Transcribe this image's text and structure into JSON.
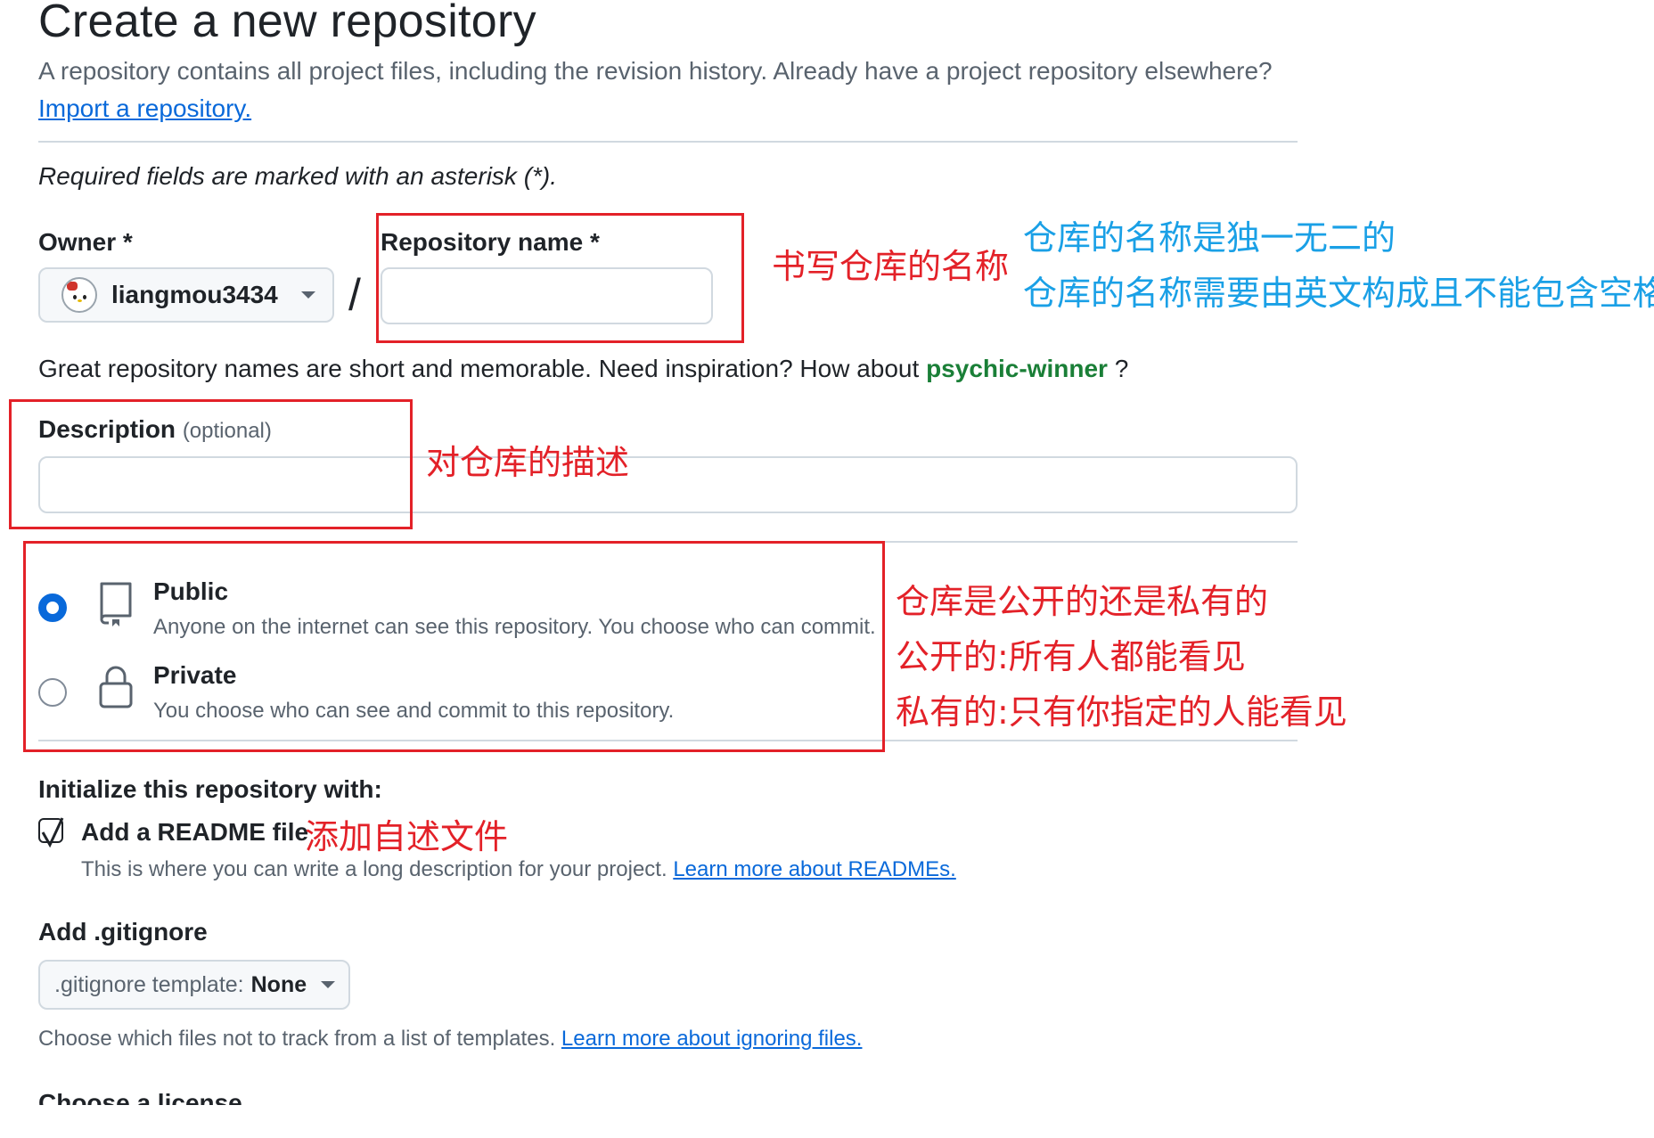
{
  "page": {
    "title": "Create a new repository",
    "intro": "A repository contains all project files, including the revision history. Already have a project repository elsewhere?",
    "import_link": "Import a repository.",
    "required_note": "Required fields are marked with an asterisk (*)."
  },
  "owner": {
    "label": "Owner *",
    "value": "liangmou3434"
  },
  "separator": "/",
  "repo_name": {
    "label": "Repository name *",
    "value": ""
  },
  "name_hint": {
    "text": "Great repository names are short and memorable. Need inspiration? How about",
    "suggestion": "psychic-winner",
    "suffix": "?"
  },
  "description": {
    "label": "Description",
    "optional": "(optional)",
    "value": ""
  },
  "visibility": {
    "options": [
      {
        "title": "Public",
        "desc": "Anyone on the internet can see this repository. You choose who can commit.",
        "checked": true,
        "icon": "repo-book-icon"
      },
      {
        "title": "Private",
        "desc": "You choose who can see and commit to this repository.",
        "checked": false,
        "icon": "lock-icon"
      }
    ]
  },
  "initialize": {
    "heading": "Initialize this repository with:",
    "readme_label": "Add a README file",
    "readme_desc": "This is where you can write a long description for your project.",
    "readme_link": "Learn more about READMEs."
  },
  "gitignore": {
    "heading": "Add .gitignore",
    "button_prefix": ".gitignore template:",
    "button_value": "None",
    "desc": "Choose which files not to track from a list of templates.",
    "link": "Learn more about ignoring files."
  },
  "license": {
    "heading": "Choose a license"
  },
  "annotations": {
    "repo_name_note": "书写仓库的名称",
    "unique_note": "仓库的名称是独一无二的",
    "english_note": "仓库的名称需要由英文构成且不能包含空格",
    "description_note": "对仓库的描述",
    "visibility_note": "仓库是公开的还是私有的",
    "public_note": "公开的:所有人都能看见",
    "private_note": "私有的:只有你指定的人能看见",
    "readme_note": "添加自述文件"
  },
  "colors": {
    "accent": "#0969da",
    "annotation_red": "#e32128",
    "annotation_blue": "#1aa0e6",
    "suggestion_green": "#1a7f37"
  }
}
